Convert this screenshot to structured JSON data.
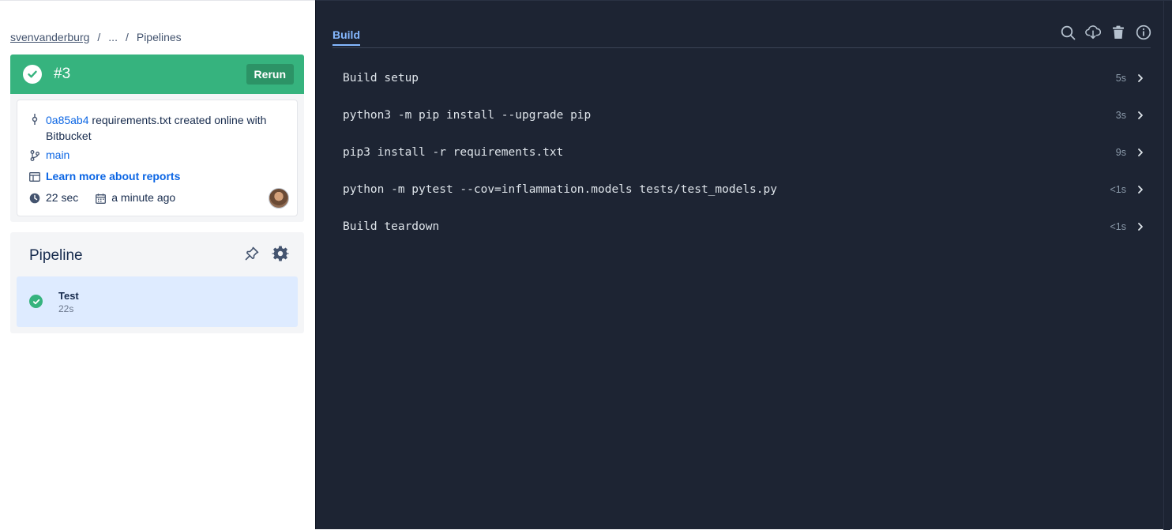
{
  "breadcrumb": {
    "user": "svenvanderburg",
    "sep1": "/",
    "ellipsis": "...",
    "sep2": "/",
    "current": "Pipelines"
  },
  "build": {
    "number": "#3",
    "rerun_label": "Rerun",
    "commit_hash": "0a85ab4",
    "commit_message": " requirements.txt created online with Bitbucket",
    "branch": "main",
    "reports_link": "Learn more about reports",
    "duration": "22 sec",
    "started": "a minute ago"
  },
  "pipeline": {
    "title": "Pipeline",
    "steps": [
      {
        "name": "Test",
        "duration": "22s"
      }
    ]
  },
  "log": {
    "tab": "Build",
    "rows": [
      {
        "command": "Build setup",
        "duration": "5s"
      },
      {
        "command": "python3 -m pip install --upgrade pip",
        "duration": "3s"
      },
      {
        "command": "pip3 install -r requirements.txt",
        "duration": "9s"
      },
      {
        "command": "python -m pytest --cov=inflammation.models tests/test_models.py",
        "duration": "<1s"
      },
      {
        "command": "Build teardown",
        "duration": "<1s"
      }
    ]
  },
  "colors": {
    "success": "#36b37e",
    "log_background": "#1d2433",
    "link": "#0c66e4",
    "selected_step": "#deebff"
  }
}
